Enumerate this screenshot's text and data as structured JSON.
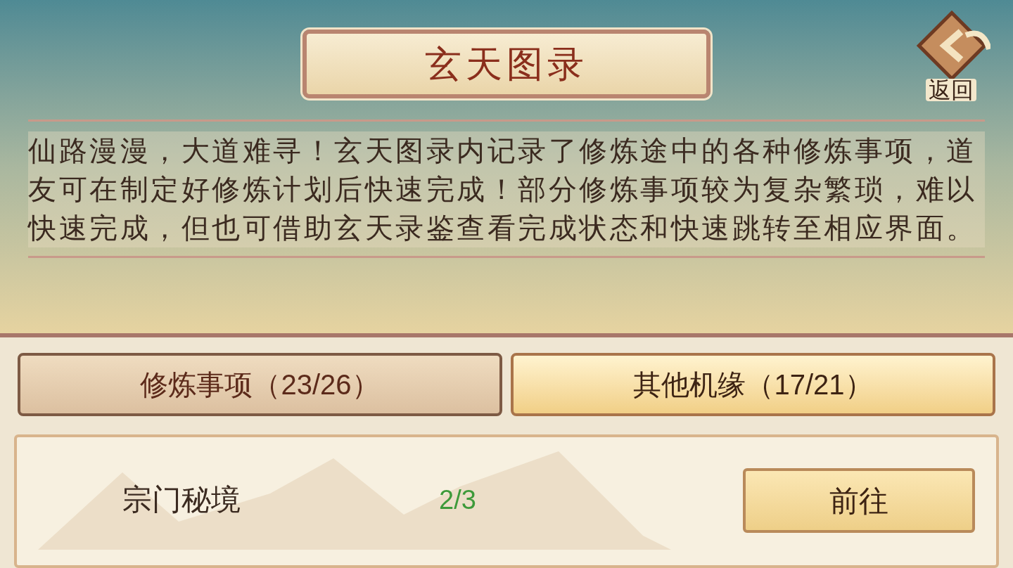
{
  "title": "玄天图录",
  "back_button": {
    "label": "返回"
  },
  "description": "仙路漫漫，大道难寻！玄天图录内记录了修炼途中的各种修炼事项，道友可在制定好修炼计划后快速完成！部分修炼事项较为复杂繁琐，难以快速完成，但也可借助玄天录鉴查看完成状态和快速跳转至相应界面。",
  "tabs": [
    {
      "label": "修炼事项（23/26）",
      "selected": false
    },
    {
      "label": "其他机缘（17/21）",
      "selected": true
    }
  ],
  "tasks": [
    {
      "name": "宗门秘境",
      "progress": "2/3",
      "color": "#3e9a3a",
      "action": "前往"
    }
  ]
}
